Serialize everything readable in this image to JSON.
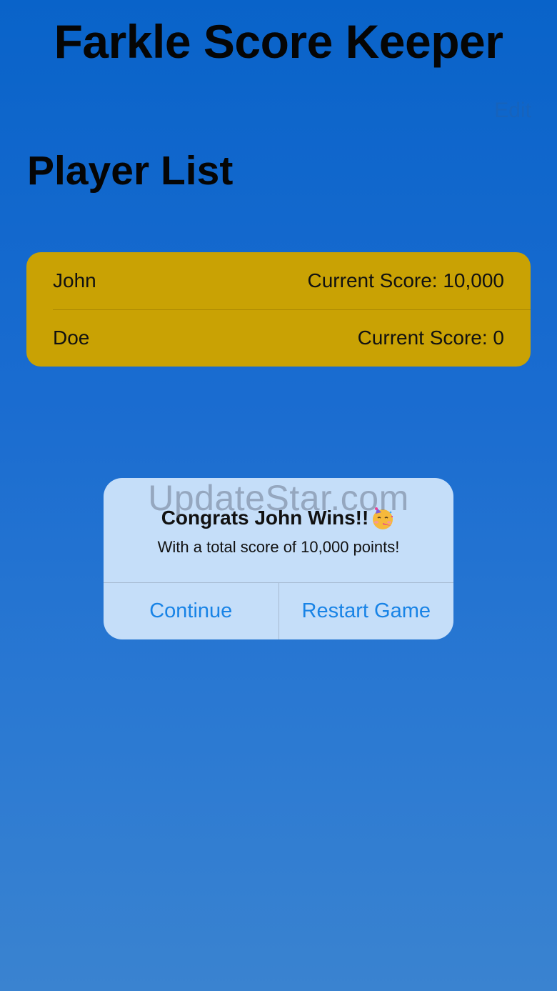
{
  "header": {
    "app_title": "Farkle Score Keeper",
    "edit_label": "Edit"
  },
  "player_list": {
    "title": "Player List",
    "players": [
      {
        "name": "John",
        "score_text": "Current Score: 10,000"
      },
      {
        "name": "Doe",
        "score_text": "Current Score: 0"
      }
    ]
  },
  "alert": {
    "title": "Congrats John Wins!!",
    "title_icon": "partying-face-emoji",
    "message": "With a total score of 10,000 points!",
    "buttons": {
      "continue_label": "Continue",
      "restart_label": "Restart Game"
    }
  },
  "watermark": {
    "text": "UpdateStar.com"
  },
  "colors": {
    "background_top": "#0963c9",
    "background_bottom": "#3a83d0",
    "player_list_bg": "#c9a204",
    "alert_bg": "#c5def9",
    "alert_button_text": "#1883e6"
  }
}
